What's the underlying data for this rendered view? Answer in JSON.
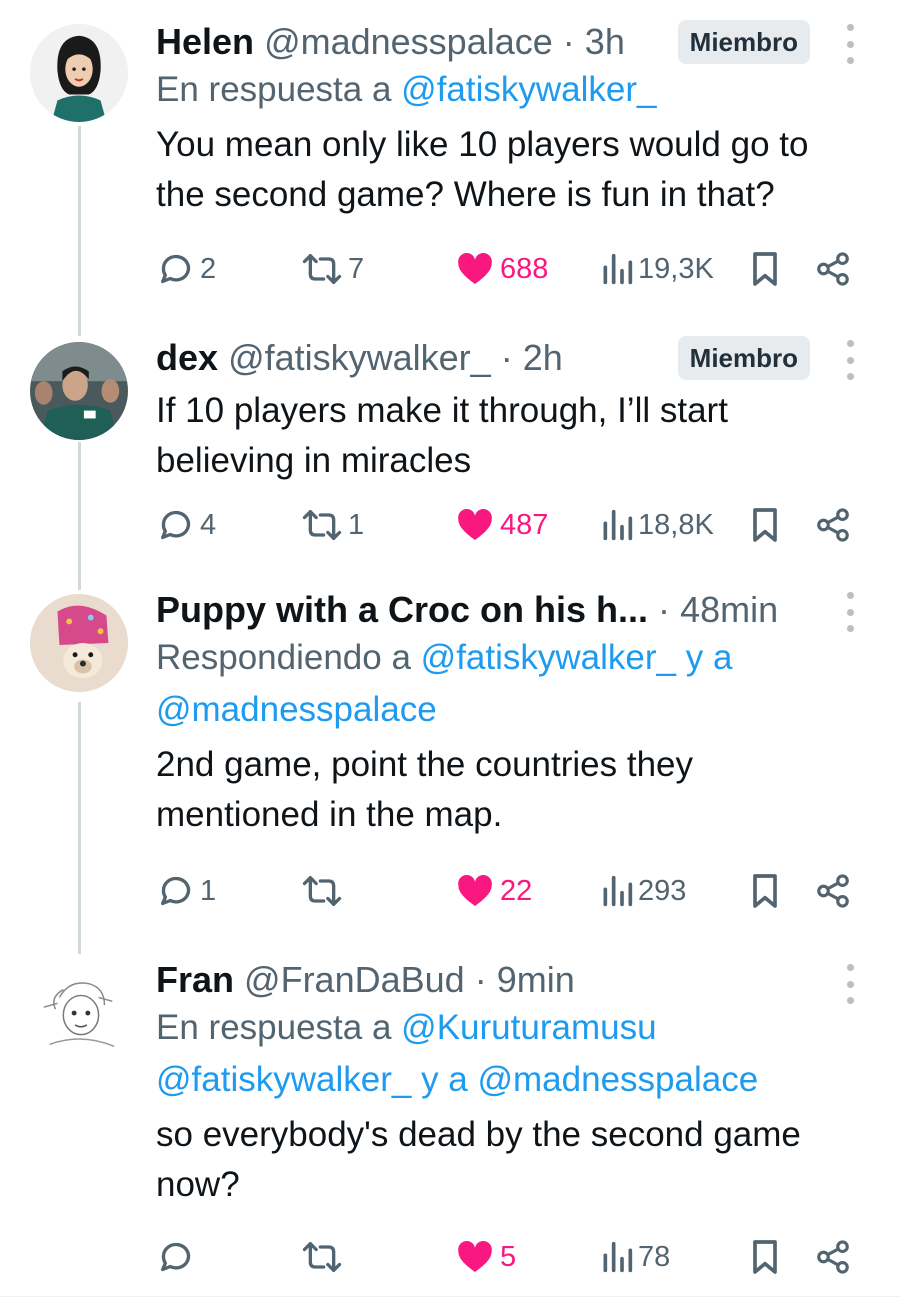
{
  "replies": [
    {
      "name": "Helen",
      "handle": "@madnesspalace",
      "time": "3h",
      "badge": "Miembro",
      "reply_prefix": "En respuesta a",
      "reply_mentions": "@fatiskywalker_",
      "text": "You mean only like 10 players would go to the second game? Where is fun in that?",
      "stats": {
        "replies": "2",
        "reposts": "7",
        "likes": "688",
        "views": "19,3K"
      }
    },
    {
      "name": "dex",
      "handle": "@fatiskywalker_",
      "time": "2h",
      "badge": "Miembro",
      "text": "If 10 players make it through, I’ll start believing in miracles",
      "stats": {
        "replies": "4",
        "reposts": "1",
        "likes": "487",
        "views": "18,8K"
      }
    },
    {
      "name": "Puppy with a Croc on his h...",
      "time": "48min",
      "reply_prefix": "Respondiendo a",
      "reply_mention_1": "@fatiskywalker_",
      "reply_joiner": "y a",
      "reply_mention_2": "@madnesspalace",
      "text": "2nd game, point the countries they mentioned in the map.",
      "stats": {
        "replies": "1",
        "reposts": "",
        "likes": "22",
        "views": "293"
      }
    },
    {
      "name": "Fran",
      "handle": "@FranDaBud",
      "time": "9min",
      "reply_prefix": "En respuesta a",
      "reply_mention_1": "@Kuruturamusu",
      "reply_mention_2": "@fatiskywalker_",
      "reply_joiner": "y a",
      "reply_mention_3": "@madnesspalace",
      "text": "so everybody's dead by the second game now?",
      "stats": {
        "replies": "",
        "reposts": "",
        "likes": "5",
        "views": "78"
      }
    }
  ],
  "separator": "·",
  "colors": {
    "like": "#f91880",
    "mention": "#1d9bf0",
    "muted": "#536471",
    "thread": "#cfd9de"
  },
  "icons": [
    "reply-icon",
    "repost-icon",
    "like-icon",
    "views-icon",
    "bookmark-icon",
    "share-icon",
    "more-icon"
  ]
}
